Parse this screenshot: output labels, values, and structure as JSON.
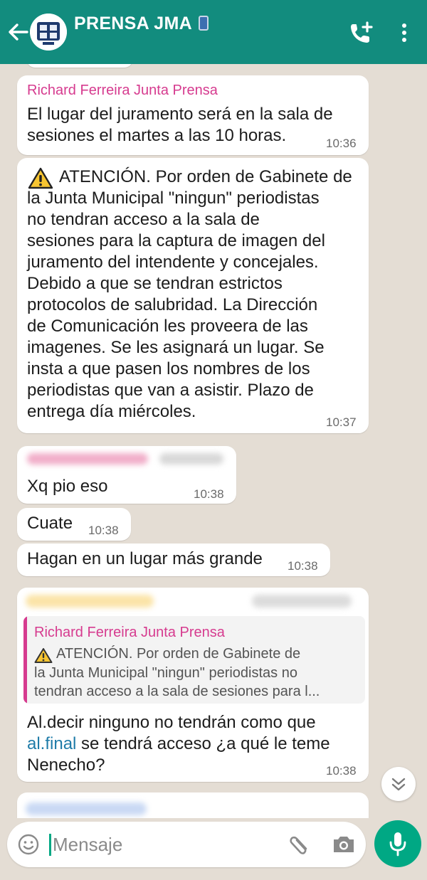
{
  "header": {
    "title": "PRENSA JMA",
    "title_emoji": "📱"
  },
  "messages": [
    {
      "sender": "Richard Ferreira Junta Prensa",
      "text": "El lugar del juramento será en la sala de\nsesiones el martes a las 10 horas.",
      "time": "10:36"
    },
    {
      "icon": "warning-icon",
      "text": "ATENCIÓN. Por orden de Gabinete de\nla Junta Municipal \"ningun\" periodistas\nno tendran acceso a la sala de\nsesiones para la captura de imagen del\njuramento del intendente y concejales.\nDebido a que se tendran estrictos\nprotocolos de salubridad. La Dirección\nde Comunicación les proveera de las\nimagenes. Se les asignará un lugar. Se\ninsta a que pasen los nombres de los\nperiodistas que van a asistir. Plazo de\nentrega día miércoles.",
      "time": "10:37"
    },
    {
      "text": "Xq pio eso",
      "time": "10:38"
    },
    {
      "text": "Cuate",
      "time": "10:38"
    },
    {
      "text": "Hagan en un lugar más grande",
      "time": "10:38"
    },
    {
      "quote": {
        "sender": "Richard Ferreira Junta Prensa",
        "icon": "warning-icon",
        "text": "ATENCIÓN. Por orden de Gabinete de\nla Junta Municipal \"ningun\" periodistas no\ntendran acceso a la sala de sesiones para l..."
      },
      "text_before_link": "Al.decir ninguno no tendrán como que\n",
      "link": "al.final",
      "text_after_link": " se tendrá acceso ¿a qué le teme\nNenecho?",
      "time": "10:38"
    }
  ],
  "composer": {
    "placeholder": "Mensaje"
  },
  "colors": {
    "header": "#128c7e",
    "chat_bg": "#e4ddd4",
    "sender_name": "#d63b8f",
    "accent": "#00a884",
    "link": "#1e7ba8"
  }
}
